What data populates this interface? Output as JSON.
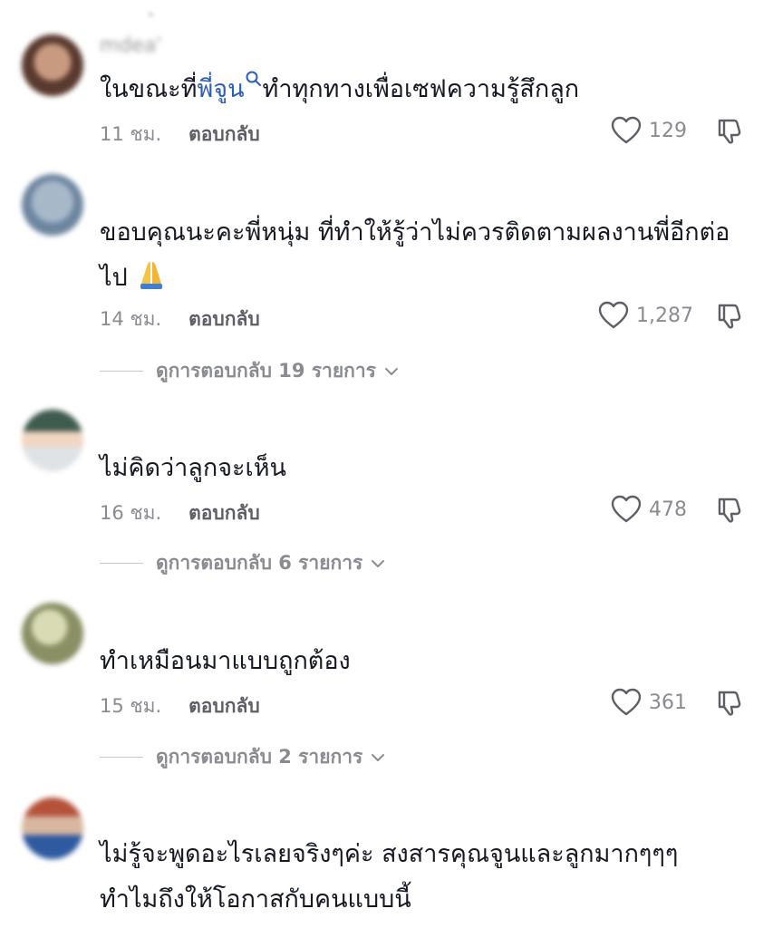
{
  "top_cutoff_text": "ู",
  "comments": [
    {
      "username": "mdea'",
      "text_before": "ในขณะที่",
      "mention": "พี่จูน",
      "text_after": "ทำทุกทางเพื่อเซฟความรู้สึกลูก",
      "time": "11 ชม.",
      "reply_label": "ตอบกลับ",
      "likes": "129",
      "avatar_colors": [
        "#5a3a2e",
        "#c89a80"
      ]
    },
    {
      "username": "",
      "text_line1": "ขอบคุณนะคะพี่หนุ่ม ที่ทำให้รู้ว่าไม่ควรติดตามผลงานพี่อีกต่อ",
      "text_line2": "ไป",
      "emoji": "folded-hands-emoji",
      "time": "14 ชม.",
      "reply_label": "ตอบกลับ",
      "likes": "1,287",
      "view_replies": "ดูการตอบกลับ 19 รายการ",
      "avatar_colors": [
        "#a7b8c9",
        "#6d86a0"
      ]
    },
    {
      "username": "",
      "text": "ไม่คิดว่าลูกจะเห็น",
      "time": "16 ชม.",
      "reply_label": "ตอบกลับ",
      "likes": "478",
      "view_replies": "ดูการตอบกลับ 6 รายการ",
      "avatar_colors": [
        "#3f5a4e",
        "#dfe3e6"
      ]
    },
    {
      "username": "",
      "text": "ทำเหมือนมาแบบถูกต้อง",
      "time": "15 ชม.",
      "reply_label": "ตอบกลับ",
      "likes": "361",
      "view_replies": "ดูการตอบกลับ 2 รายการ",
      "avatar_colors": [
        "#c8c9a3",
        "#8a8f64"
      ]
    },
    {
      "username": "",
      "text_line1": "ไม่รู้จะพูดอะไรเลยจริงๆค่ะ สงสารคุณจูนและลูกมากๆๆๆ",
      "text_line2": "ทำไมถึงให้โอกาสกับคนแบบนี้",
      "avatar_colors": [
        "#b5523a",
        "#2f5aa0"
      ]
    }
  ],
  "colors": {
    "text": "#161823",
    "mention": "#2b5db9",
    "meta": "#8a8b91"
  }
}
